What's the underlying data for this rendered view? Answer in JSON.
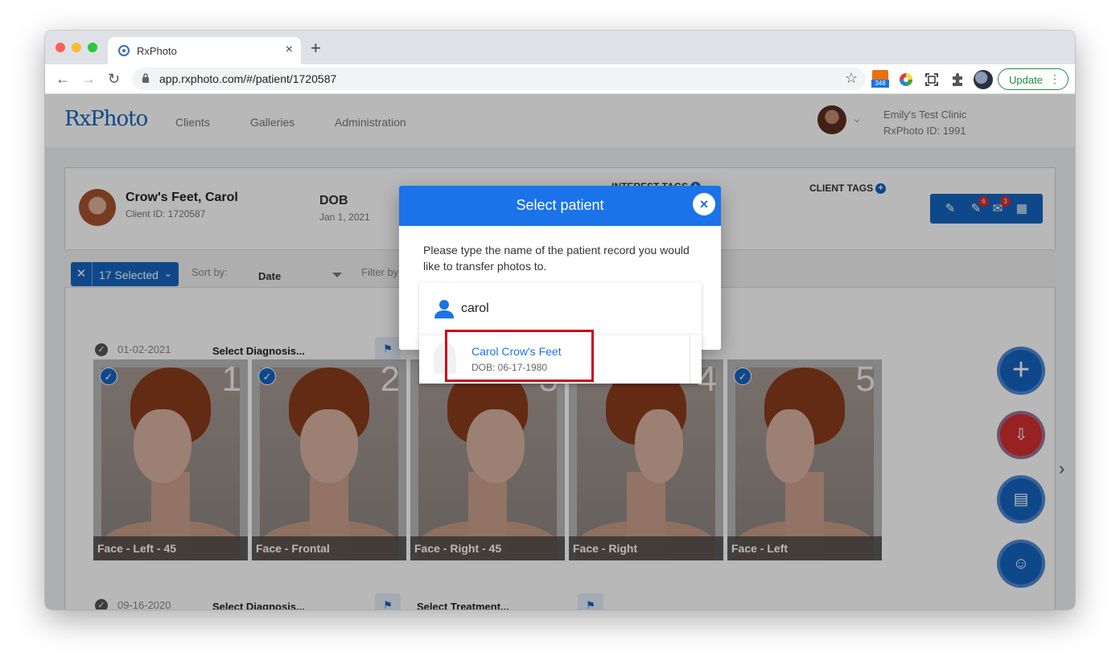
{
  "browser": {
    "tab_title": "RxPhoto",
    "tab_close": "×",
    "new_tab": "+",
    "url": "app.rxphoto.com/#/patient/1720587",
    "extension_badge": "348",
    "update_label": "Update",
    "update_menu": "⋮"
  },
  "app": {
    "logo": "RxPhoto",
    "nav": [
      "Clients",
      "Galleries",
      "Administration"
    ],
    "clinic_name": "Emily's Test Clinic",
    "clinic_id": "RxPhoto ID: 1991"
  },
  "client": {
    "name": "Crow's Feet, Carol",
    "id": "Client ID: 1720587",
    "dob_label": "DOB",
    "dob_value": "Jan 1, 2021",
    "interest_tags_label": "INTEREST TAGS",
    "client_tags_label": "CLIENT TAGS",
    "plus": "+",
    "badges": {
      "edit_count": "6",
      "message_count": "3"
    }
  },
  "filter": {
    "selected_label": "17 Selected",
    "sort_by_label": "Sort by:",
    "sort_value": "Date",
    "filter_by_label": "Filter by"
  },
  "sessions": [
    {
      "date": "01-02-2021",
      "diagnosis": "Select Diagnosis...",
      "treatment": ""
    },
    {
      "date": "09-16-2020",
      "diagnosis": "Select Diagnosis...",
      "treatment": "Select Treatment..."
    }
  ],
  "photos": [
    {
      "num": "1",
      "label": "Face - Left - 45",
      "checked": true
    },
    {
      "num": "2",
      "label": "Face - Frontal",
      "checked": true
    },
    {
      "num": "3",
      "label": "Face - Right - 45",
      "checked": false
    },
    {
      "num": "4",
      "label": "Face - Right",
      "checked": false
    },
    {
      "num": "5",
      "label": "Face - Left",
      "checked": true
    }
  ],
  "modal": {
    "title": "Select patient",
    "close": "×",
    "instructions": "Please type the name of the patient record you would like to transfer photos to.",
    "search_value": "carol",
    "results": [
      {
        "name": "Carol Crow's Feet",
        "dob": "DOB: 06-17-1980"
      }
    ]
  },
  "colors": {
    "brand_blue": "#1565c0",
    "modal_blue": "#1a73e8",
    "fab_red": "#d32f2f",
    "highlight_red": "#d0021b"
  }
}
